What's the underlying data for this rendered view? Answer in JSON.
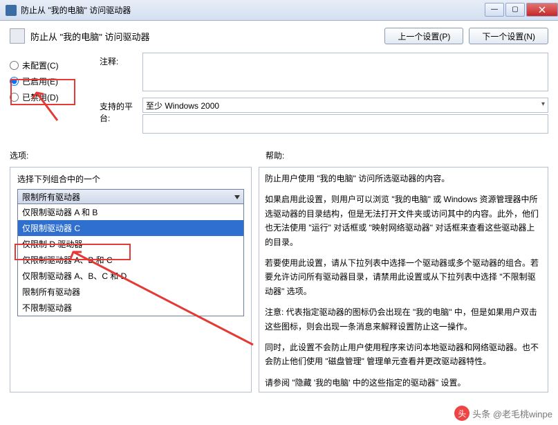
{
  "window": {
    "title": "防止从 \"我的电脑\" 访问驱动器",
    "buttons": {
      "prev": "上一个设置(P)",
      "next": "下一个设置(N)"
    }
  },
  "radios": {
    "not_configured": "未配置(C)",
    "enabled": "已启用(E)",
    "disabled": "已禁用(D)"
  },
  "fields": {
    "comment": "注释:",
    "platform_label": "支持的平台:",
    "platform_value": "至少 Windows 2000"
  },
  "section": {
    "options": "选项:",
    "help": "帮助:"
  },
  "dropdown": {
    "title": "选择下列组合中的一个",
    "selected": "限制所有驱动器",
    "items": [
      "仅限制驱动器 A 和 B",
      "仅限制驱动器 C",
      "仅限制 D 驱动器",
      "仅限制驱动器 A、B 和 C",
      "仅限制驱动器 A、B、C 和 D",
      "限制所有驱动器",
      "不限制驱动器"
    ]
  },
  "help": {
    "p1": "防止用户使用 \"我的电脑\" 访问所选驱动器的内容。",
    "p2": "如果启用此设置，则用户可以浏览 \"我的电脑\" 或 Windows 资源管理器中所选驱动器的目录结构，但是无法打开文件夹或访问其中的内容。此外，他们也无法使用 \"运行\" 对话框或 \"映射网络驱动器\" 对话框来查看这些驱动器上的目录。",
    "p3": "若要使用此设置，请从下拉列表中选择一个驱动器或多个驱动器的组合。若要允许访问所有驱动器目录，请禁用此设置或从下拉列表中选择 \"不限制驱动器\" 选项。",
    "p4": "注意: 代表指定驱动器的图标仍会出现在 \"我的电脑\" 中，但是如果用户双击这些图标，则会出现一条消息来解释设置防止这一操作。",
    "p5": "同时，此设置不会防止用户使用程序来访问本地驱动器和网络驱动器。也不会防止他们使用 \"磁盘管理\" 管理单元查看并更改驱动器特性。",
    "p6": "请参阅 \"隐藏 '我的电脑' 中的这些指定的驱动器\" 设置。"
  },
  "watermark": "头条 @老毛桃winpe"
}
